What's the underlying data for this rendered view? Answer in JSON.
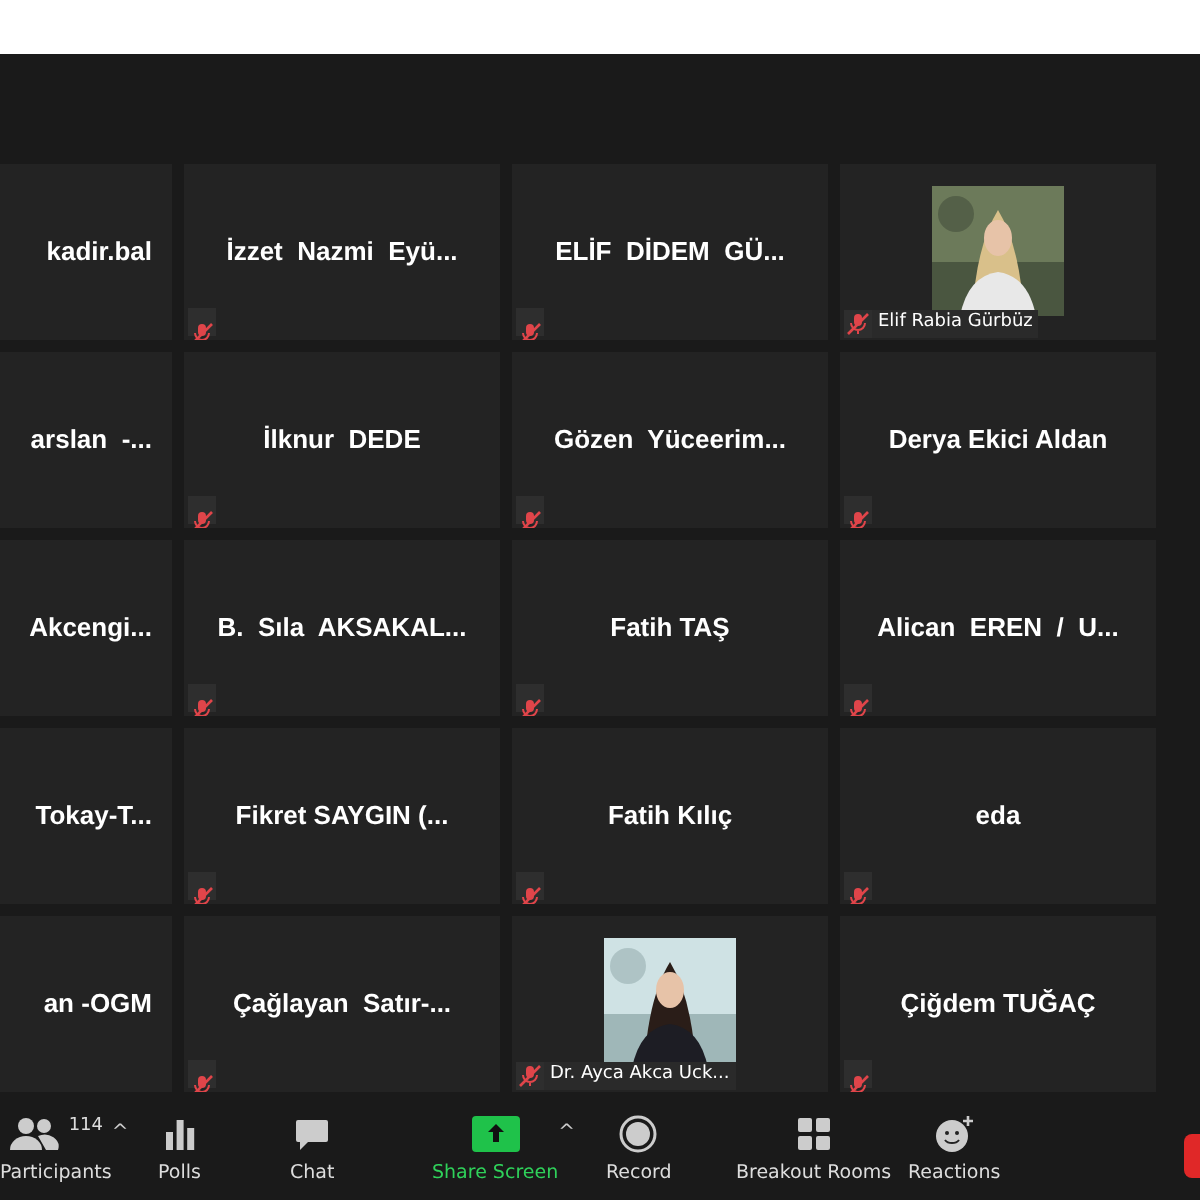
{
  "tiles": [
    {
      "kind": "name",
      "name": "kadir.bal",
      "edge": true
    },
    {
      "kind": "name",
      "name": "İzzet  Nazmi  Eyü...",
      "muted": true
    },
    {
      "kind": "name",
      "name": "ELİF  DİDEM  GÜ...",
      "muted": true
    },
    {
      "kind": "picture",
      "name": "Elif Rabia Gürbüz",
      "muted": true
    },
    {
      "kind": "name",
      "name": "arslan  -...",
      "edge": true
    },
    {
      "kind": "name",
      "name": "İlknur  DEDE",
      "muted": true
    },
    {
      "kind": "name",
      "name": "Gözen  Yüceerim...",
      "muted": true
    },
    {
      "kind": "name",
      "name": "Derya Ekici Aldan",
      "muted": true
    },
    {
      "kind": "name",
      "name": "Akcengi...",
      "edge": true
    },
    {
      "kind": "name",
      "name": "B.  Sıla  AKSAKAL...",
      "muted": true
    },
    {
      "kind": "name",
      "name": "Fatih TAŞ",
      "muted": true
    },
    {
      "kind": "name",
      "name": "Alican  EREN  /  U...",
      "muted": true
    },
    {
      "kind": "name",
      "name": "Tokay-T...",
      "edge": true
    },
    {
      "kind": "name",
      "name": "Fikret SAYGIN (...",
      "muted": true
    },
    {
      "kind": "name",
      "name": "Fatih Kılıç",
      "muted": true
    },
    {
      "kind": "name",
      "name": "eda",
      "muted": true
    },
    {
      "kind": "name",
      "name": "an -OGM",
      "edge": true
    },
    {
      "kind": "name",
      "name": "Çağlayan  Satır-...",
      "muted": true
    },
    {
      "kind": "picture",
      "name": "Dr. Ayca Akca Uck...",
      "muted": true
    },
    {
      "kind": "name",
      "name": "Çiğdem TUĞAÇ",
      "muted": true
    }
  ],
  "toolbar": [
    {
      "kind": "participants",
      "label": "Participants",
      "count": "114",
      "caret": "^"
    },
    {
      "kind": "polls",
      "label": "Polls"
    },
    {
      "kind": "chat",
      "label": "Chat"
    },
    {
      "kind": "share",
      "label": "Share Screen",
      "caret": "^"
    },
    {
      "kind": "record",
      "label": "Record"
    },
    {
      "kind": "breakout",
      "label": "Breakout Rooms"
    },
    {
      "kind": "reactions",
      "label": "Reactions"
    },
    {
      "kind": "end"
    }
  ]
}
